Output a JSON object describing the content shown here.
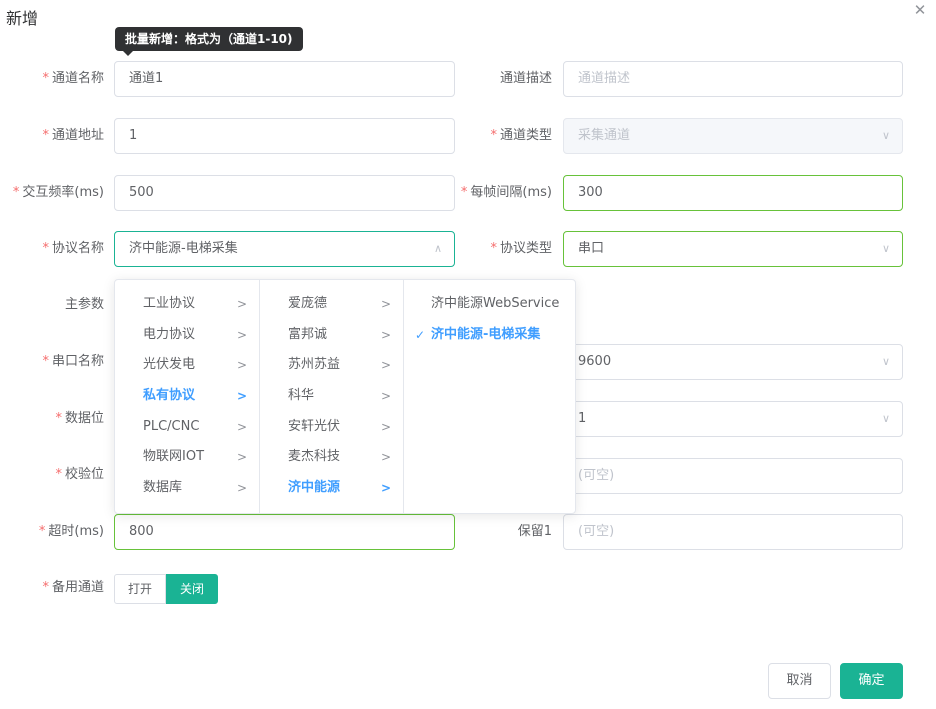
{
  "dialog": {
    "title": "新增",
    "close_icon": "close-icon"
  },
  "tooltip": "批量新增：格式为（通道1-10)",
  "form": {
    "channel_name": {
      "label": "通道名称",
      "value": "通道1"
    },
    "channel_desc": {
      "label": "通道描述",
      "placeholder": "通道描述"
    },
    "channel_addr": {
      "label": "通道地址",
      "value": "1"
    },
    "channel_type": {
      "label": "通道类型",
      "value": "采集通道"
    },
    "interval": {
      "label": "交互频率(ms)",
      "value": "500"
    },
    "frame_gap": {
      "label": "每帧间隔(ms)",
      "value": "300"
    },
    "protocol_name": {
      "label": "协议名称",
      "value": "济中能源-电梯采集"
    },
    "protocol_type": {
      "label": "协议类型",
      "value": "串口"
    },
    "main_param": {
      "label": "主参数"
    },
    "serial_name": {
      "label": "串口名称"
    },
    "baud_rate": {
      "value": "9600"
    },
    "data_bits": {
      "label": "数据位"
    },
    "stop_bits": {
      "value": "1"
    },
    "parity": {
      "label": "校验位"
    },
    "reserved0": {
      "placeholder": "(可空)"
    },
    "timeout": {
      "label": "超时(ms)",
      "value": "800"
    },
    "reserved1": {
      "label": "保留1",
      "placeholder": "(可空)"
    },
    "backup_channel": {
      "label": "备用通道",
      "on": "打开",
      "off": "关闭",
      "selected": "关闭"
    }
  },
  "cascader": {
    "level1": [
      "工业协议",
      "电力协议",
      "光伏发电",
      "私有协议",
      "PLC/CNC",
      "物联网IOT",
      "数据库"
    ],
    "level1_active": "私有协议",
    "level2": [
      "爱庞德",
      "富邦诚",
      "苏州苏益",
      "科华",
      "安轩光伏",
      "麦杰科技",
      "济中能源"
    ],
    "level2_active": "济中能源",
    "level3": [
      "济中能源WebService",
      "济中能源-电梯采集"
    ],
    "level3_active": "济中能源-电梯采集"
  },
  "buttons": {
    "cancel": "取消",
    "ok": "确定"
  },
  "colors": {
    "primary": "#1ab394",
    "active_link": "#409eff",
    "required": "#f56c6c",
    "focus_green": "#67c23a"
  }
}
